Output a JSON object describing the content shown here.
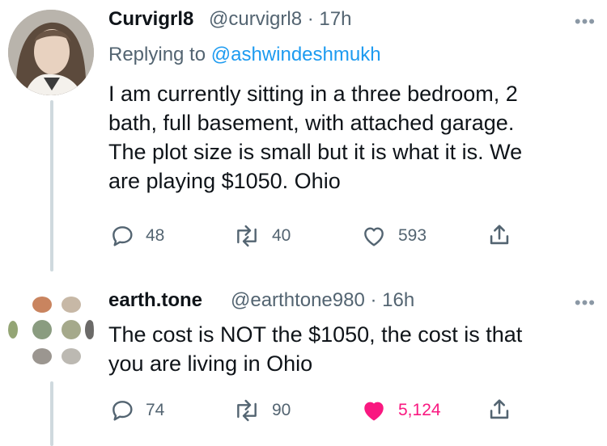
{
  "tweets": [
    {
      "display_name": "Curvigrl8",
      "handle_time": "@curvigrl8 · 17h",
      "reply_prefix": "Replying to ",
      "reply_to": "@ashwindeshmukh",
      "text": "I am currently sitting in a three bedroom, 2\nbath, full basement, with attached garage.\nThe plot size is small but it is what it is. We\nare playing $1050. Ohio",
      "more": "•••",
      "replies": "48",
      "retweets": "40",
      "likes": "593",
      "liked": false
    },
    {
      "display_name": "earth.tone",
      "handle_time": "@earthtone980 · 16h",
      "text": "The cost is NOT the $1050, the cost is that\nyou are living in Ohio",
      "more": "•••",
      "replies": "74",
      "retweets": "90",
      "likes": "5,124",
      "liked": true
    }
  ],
  "colors": {
    "text": "#0f1419",
    "secondary": "#536471",
    "link": "#1d9bf0",
    "like": "#f91880",
    "thread_line": "#cfd9de"
  },
  "avatar2_dots": [
    "#c9845f",
    "#c7b8a6",
    "#94a575",
    "#8a9c80",
    "#a5a98b",
    "#9b9690",
    "#bcb9b2"
  ]
}
